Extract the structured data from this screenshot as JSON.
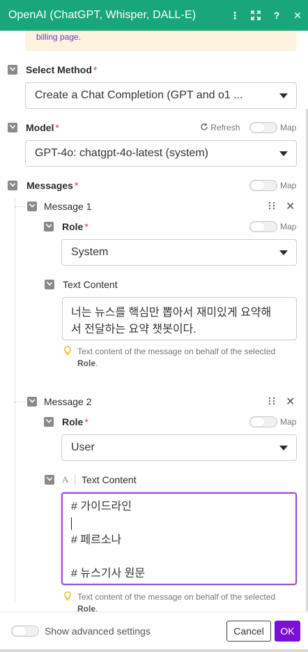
{
  "window": {
    "title": "OpenAI (ChatGPT, Whisper, DALL-E)"
  },
  "header_icons": [
    "more-vertical-icon",
    "expand-icon",
    "help-icon",
    "close-icon"
  ],
  "header_glyphs": {
    "more": "⋮",
    "expand": "⛶",
    "help": "?",
    "close": "✕"
  },
  "notice": {
    "text": "billing page."
  },
  "method": {
    "label": "Select Method",
    "required": "*",
    "value": "Create a Chat Completion (GPT and o1 ..."
  },
  "model": {
    "label": "Model",
    "required": "*",
    "refresh": "Refresh",
    "map": "Map",
    "value": "GPT-4o: chatgpt-4o-latest (system)"
  },
  "messages": {
    "label": "Messages",
    "required": "*",
    "map": "Map",
    "items": [
      {
        "title": "Message 1",
        "role_label": "Role",
        "role_required": "*",
        "role_map": "Map",
        "role_value": "System",
        "content_label": "Text Content",
        "content_lines": [
          "너는 뉴스를 핵심만 뽑아서 재미있게 요약해",
          "서 전달하는 요약 챗봇이다."
        ],
        "hint_text": "Text content of the message on behalf of the selected",
        "hint_bold": "Role",
        "hint_end": "."
      },
      {
        "title": "Message 2",
        "role_label": "Role",
        "role_required": "*",
        "role_map": "Map",
        "role_value": "User",
        "content_type_glyph": "A",
        "content_label": "Text Content",
        "content_lines": [
          "# 가이드라인",
          "",
          "# 페르소나",
          "",
          "# 뉴스기사 원문"
        ],
        "hint_text": "Text content of the message on behalf of the selected",
        "hint_bold": "Role",
        "hint_end": "."
      }
    ]
  },
  "footer": {
    "advanced_label": "Show advanced settings",
    "cancel": "Cancel",
    "ok": "OK"
  },
  "colors": {
    "header": "#18a77a",
    "ok_button": "#7b0fd6",
    "active_border": "#9b4ad9",
    "required": "#e0333a",
    "notice_bg": "#fcf2dd"
  }
}
